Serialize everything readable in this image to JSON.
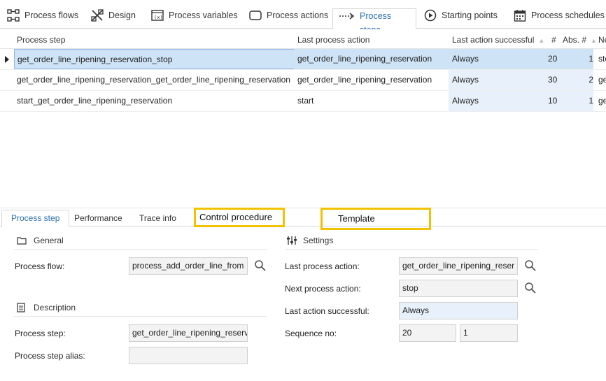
{
  "top_tabs": [
    {
      "label": "Process flows",
      "icon": "process-flows-icon"
    },
    {
      "label": "Design",
      "icon": "design-icon"
    },
    {
      "label": "Process variables",
      "icon": "variables-icon"
    },
    {
      "label": "Process actions",
      "icon": "actions-icon"
    },
    {
      "label": "Process steps",
      "icon": "steps-icon",
      "active": true
    },
    {
      "label": "Starting points",
      "icon": "play-icon"
    },
    {
      "label": "Process schedules",
      "icon": "calendar-icon"
    }
  ],
  "grid": {
    "columns": [
      "Process step",
      "Last process action",
      "Last action successful",
      "#",
      "Abs. #",
      "Ne"
    ],
    "rows": [
      {
        "step": "get_order_line_ripening_reservation_stop",
        "action": "get_order_line_ripening_reservation",
        "successful": "Always",
        "num": "20",
        "abs": "1",
        "next": "sto",
        "selected": true
      },
      {
        "step": "get_order_line_ripening_reservation_get_order_line_ripening_reservation",
        "action": "get_order_line_ripening_reservation",
        "successful": "Always",
        "num": "30",
        "abs": "2",
        "next": "ge"
      },
      {
        "step": "start_get_order_line_ripening_reservation",
        "action": "start",
        "successful": "Always",
        "num": "10",
        "abs": "1",
        "next": "ge"
      }
    ]
  },
  "bottom_tabs": [
    "Process step",
    "Performance",
    "Trace info",
    "Control procedure",
    "Template"
  ],
  "form": {
    "general_title": "General",
    "settings_title": "Settings",
    "description_title": "Description",
    "process_flow_label": "Process flow:",
    "process_flow_value": "process_add_order_line_from",
    "last_action_label": "Last process action:",
    "last_action_value": "get_order_line_ripening_reser",
    "next_action_label": "Next process action:",
    "next_action_value": "stop",
    "last_successful_label": "Last action successful:",
    "last_successful_value": "Always",
    "sequence_label": "Sequence no:",
    "sequence_value": "20",
    "sequence_abs_value": "1",
    "process_step_label": "Process step:",
    "process_step_value": "get_order_line_ripening_reserva",
    "alias_label": "Process step alias:",
    "alias_value": ""
  },
  "colors": {
    "accent": "#2a6fb0",
    "highlight": "#f2c200",
    "selection": "#cfe3f7"
  }
}
